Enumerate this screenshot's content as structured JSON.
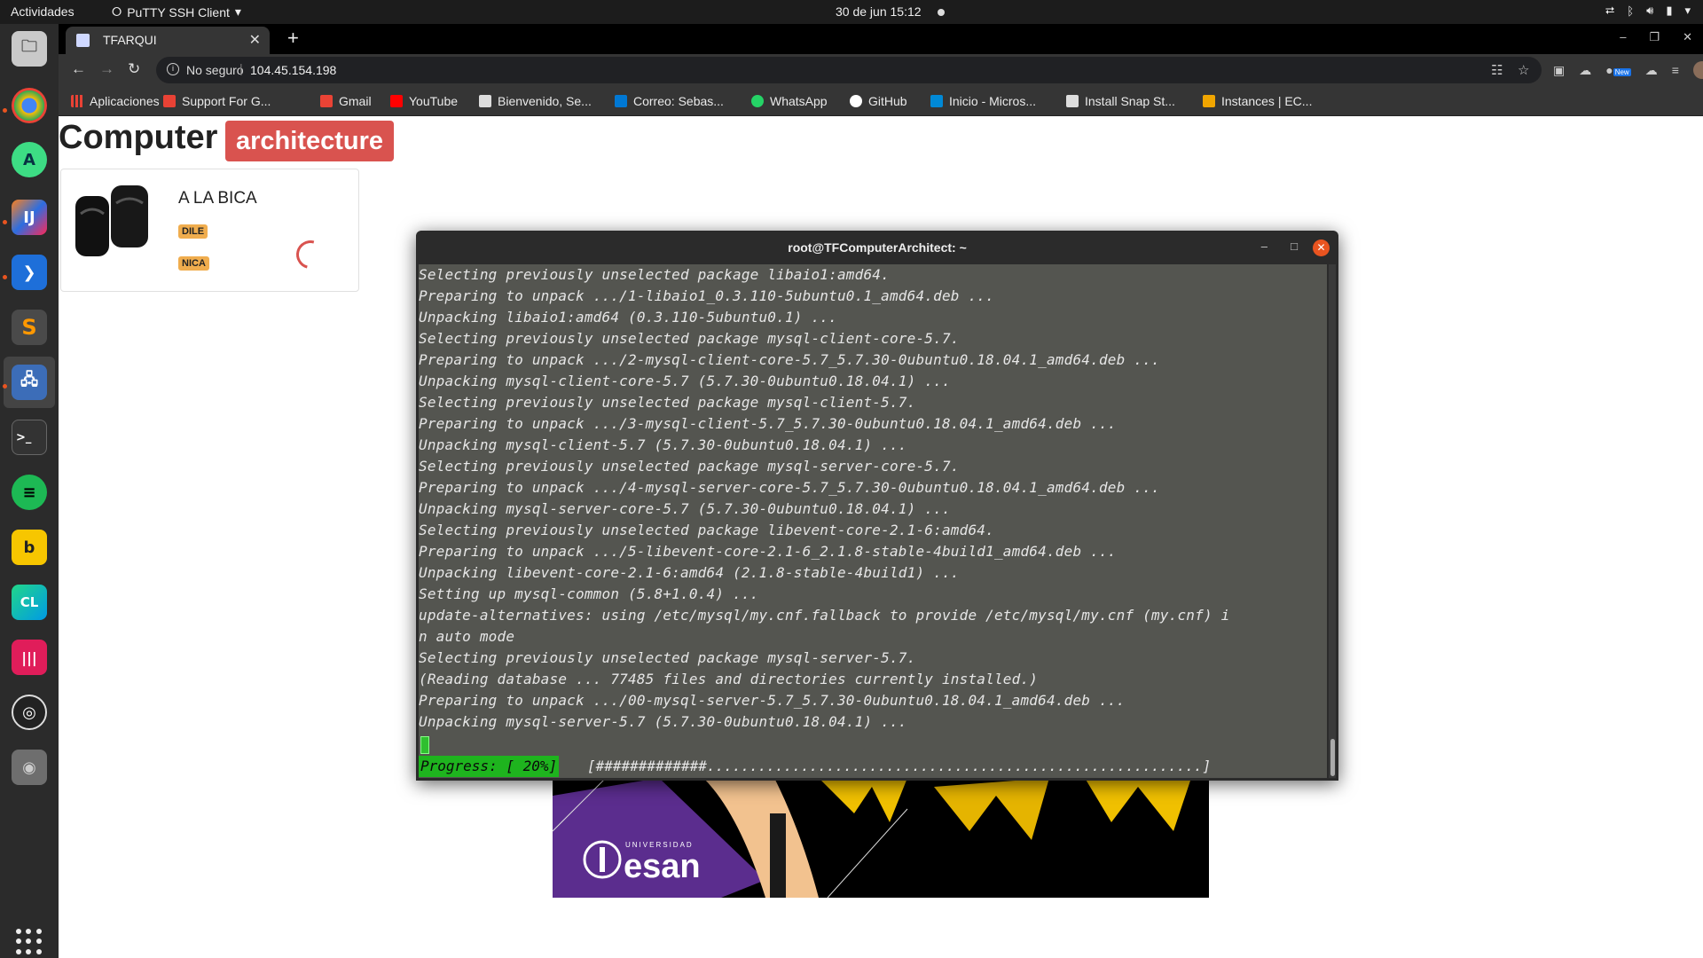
{
  "topbar": {
    "activities": "Actividades",
    "app_name": "PuTTY SSH Client",
    "clock": "30 de jun  15:12"
  },
  "browser": {
    "tab_title": "TFARQUI",
    "security_label": "No seguro",
    "url": "104.45.154.198",
    "extension_badge": "New",
    "bookmarks": [
      {
        "label": "Aplicaciones",
        "icon": "apps-grid-icon",
        "color": "#e94235"
      },
      {
        "label": "Support For G...",
        "icon": "shield-icon",
        "color": "#e94235"
      },
      {
        "label": "Gmail",
        "icon": "gmail-icon",
        "color": "#ea4335"
      },
      {
        "label": "YouTube",
        "icon": "youtube-icon",
        "color": "#ff0000"
      },
      {
        "label": "Bienvenido, Se...",
        "icon": "bb-icon",
        "color": "#dddddd"
      },
      {
        "label": "Correo: Sebas...",
        "icon": "outlook-icon",
        "color": "#0078d4"
      },
      {
        "label": "WhatsApp",
        "icon": "whatsapp-icon",
        "color": "#25d366"
      },
      {
        "label": "GitHub",
        "icon": "github-icon",
        "color": "#ffffff"
      },
      {
        "label": "Inicio - Micros...",
        "icon": "azure-icon",
        "color": "#0089d6"
      },
      {
        "label": "Install Snap St...",
        "icon": "snap-icon",
        "color": "#dddddd"
      },
      {
        "label": "Instances | EC...",
        "icon": "aws-icon",
        "color": "#f0a500"
      }
    ]
  },
  "page": {
    "title": "Computer",
    "badge": "architecture",
    "card": {
      "name": "A LA BICA",
      "tag1": "DILE",
      "tag2": "NICA"
    },
    "banner_university_small": "UNIVERSIDAD",
    "banner_university": "esan"
  },
  "putty": {
    "title": "root@TFComputerArchitect: ~",
    "lines": [
      "Selecting previously unselected package libaio1:amd64.",
      "Preparing to unpack .../1-libaio1_0.3.110-5ubuntu0.1_amd64.deb ...",
      "Unpacking libaio1:amd64 (0.3.110-5ubuntu0.1) ...",
      "Selecting previously unselected package mysql-client-core-5.7.",
      "Preparing to unpack .../2-mysql-client-core-5.7_5.7.30-0ubuntu0.18.04.1_amd64.deb ...",
      "Unpacking mysql-client-core-5.7 (5.7.30-0ubuntu0.18.04.1) ...",
      "Selecting previously unselected package mysql-client-5.7.",
      "Preparing to unpack .../3-mysql-client-5.7_5.7.30-0ubuntu0.18.04.1_amd64.deb ...",
      "Unpacking mysql-client-5.7 (5.7.30-0ubuntu0.18.04.1) ...",
      "Selecting previously unselected package mysql-server-core-5.7.",
      "Preparing to unpack .../4-mysql-server-core-5.7_5.7.30-0ubuntu0.18.04.1_amd64.deb ...",
      "Unpacking mysql-server-core-5.7 (5.7.30-0ubuntu0.18.04.1) ...",
      "Selecting previously unselected package libevent-core-2.1-6:amd64.",
      "Preparing to unpack .../5-libevent-core-2.1-6_2.1.8-stable-4build1_amd64.deb ...",
      "Unpacking libevent-core-2.1-6:amd64 (2.1.8-stable-4build1) ...",
      "Setting up mysql-common (5.8+1.0.4) ...",
      "update-alternatives: using /etc/mysql/my.cnf.fallback to provide /etc/mysql/my.cnf (my.cnf) i",
      "n auto mode",
      "Selecting previously unselected package mysql-server-5.7.",
      "(Reading database ... 77485 files and directories currently installed.)",
      "Preparing to unpack .../00-mysql-server-5.7_5.7.30-0ubuntu0.18.04.1_amd64.deb ...",
      "Unpacking mysql-server-5.7 (5.7.30-0ubuntu0.18.04.1) ..."
    ],
    "progress_label": "Progress: [ 20%]",
    "progress_bar": "[#############..........................................................]"
  },
  "colors": {
    "terminal_bg": "#545550",
    "progress_green": "#1eb41e",
    "badge_red": "#d9534f",
    "tag_orange": "#f0ad4e",
    "ubuntu_orange": "#e95420"
  }
}
